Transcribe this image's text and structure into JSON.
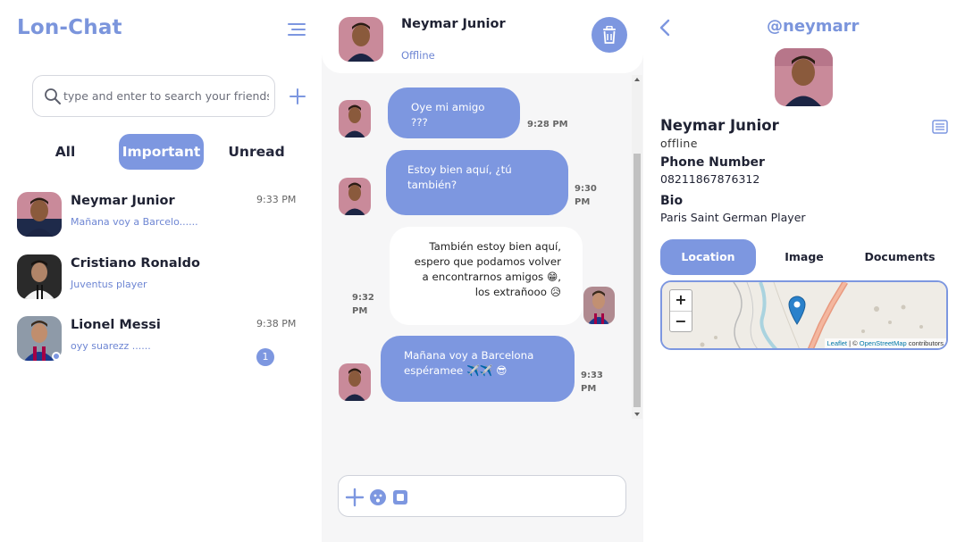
{
  "app": {
    "brand": "Lon-Chat",
    "accent": "#7d97e0"
  },
  "sidebar": {
    "search_placeholder": "type and enter to search your friends",
    "filters": [
      "All",
      "Important",
      "Unread"
    ],
    "active_filter": "Important",
    "contacts": [
      {
        "name": "Neymar Junior",
        "preview": "Mañana voy a Barcelo......",
        "time": "9:33 PM"
      },
      {
        "name": "Cristiano Ronaldo",
        "preview": "Juventus player",
        "time": ""
      },
      {
        "name": "Lionel Messi",
        "preview": "oyy suarezz ......",
        "time": "9:38 PM",
        "unread": "1"
      }
    ]
  },
  "chat": {
    "name": "Neymar Junior",
    "status": "Offline",
    "messages": [
      {
        "direction": "incoming",
        "text": "Oye mi amigo ???",
        "time": "9:28 PM"
      },
      {
        "direction": "incoming",
        "text": "Estoy bien aquí, ¿tú también?",
        "time": "9:30 PM"
      },
      {
        "direction": "outgoing",
        "text": "También estoy bien aquí, espero que podamos volver a encontrarnos amigos 😁, los extrañooo 😥",
        "time": "9:32 PM"
      },
      {
        "direction": "incoming",
        "text": "Mañana voy a Barcelona espéramee ✈️✈️ 😎",
        "time": "9:33 PM"
      }
    ]
  },
  "profile": {
    "handle": "@neymarr",
    "name": "Neymar Junior",
    "status": "offline",
    "phone_label": "Phone Number",
    "phone": "08211867876312",
    "bio_label": "Bio",
    "bio": "Paris Saint German Player",
    "tabs": [
      "Location",
      "Image",
      "Documents"
    ],
    "active_tab": "Location",
    "map": {
      "zoom_in": "+",
      "zoom_out": "−",
      "attribution_leaflet": "Leaflet",
      "attribution_sep": " | © ",
      "attribution_osm": "OpenStreetMap",
      "attribution_suffix": " contributors"
    }
  },
  "icons": [
    "menu-icon",
    "search-icon",
    "plus-icon",
    "trash-icon",
    "emoji-icon",
    "image-icon",
    "back-icon",
    "notes-icon",
    "map-marker-icon"
  ]
}
